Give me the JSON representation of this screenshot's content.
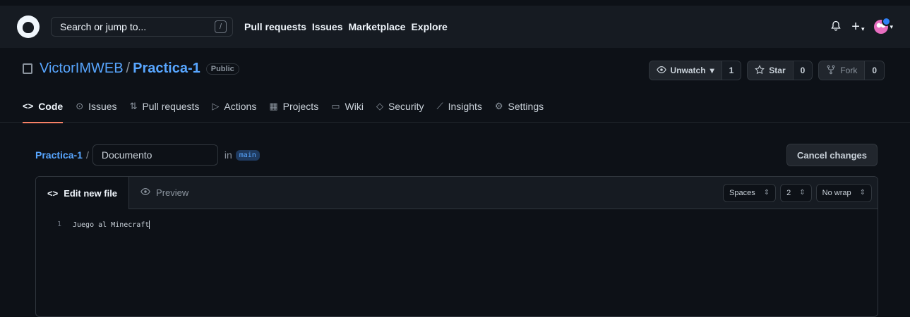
{
  "topbar": {
    "search_placeholder": "Search or jump to...",
    "search_shortcut": "/",
    "nav": [
      "Pull requests",
      "Issues",
      "Marketplace",
      "Explore"
    ],
    "plus": "+",
    "caret": "▾"
  },
  "repo": {
    "owner": "VictorIMWEB",
    "separator": "/",
    "name": "Practica-1",
    "visibility": "Public",
    "unwatch_label": "Unwatch",
    "unwatch_count": "1",
    "star_label": "Star",
    "star_count": "0",
    "fork_label": "Fork",
    "fork_count": "0"
  },
  "tabs": [
    {
      "icon": "<>",
      "label": "Code"
    },
    {
      "icon": "⊙",
      "label": "Issues"
    },
    {
      "icon": "⇅",
      "label": "Pull requests"
    },
    {
      "icon": "▷",
      "label": "Actions"
    },
    {
      "icon": "▦",
      "label": "Projects"
    },
    {
      "icon": "▭",
      "label": "Wiki"
    },
    {
      "icon": "◇",
      "label": "Security"
    },
    {
      "icon": "⟋",
      "label": "Insights"
    },
    {
      "icon": "⚙",
      "label": "Settings"
    }
  ],
  "editor": {
    "path_root": "Practica-1",
    "path_sep": "/",
    "filename": "Documento",
    "in_label": "in",
    "branch": "main",
    "cancel_label": "Cancel changes",
    "edit_tab": "Edit new file",
    "preview_tab": "Preview",
    "indent_mode": "Spaces",
    "indent_size": "2",
    "wrap_mode": "No wrap",
    "lines": [
      {
        "number": "1",
        "text": "Juego al Minecraft"
      }
    ]
  },
  "colors": {
    "accent_tab": "#f78166",
    "link": "#58a6ff",
    "bg": "#0d1117"
  }
}
